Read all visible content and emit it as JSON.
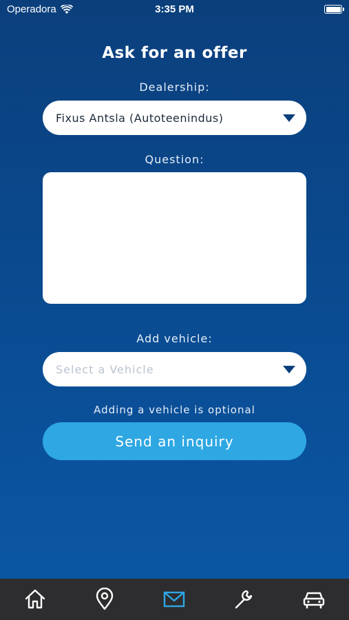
{
  "status_bar": {
    "carrier": "Operadora",
    "time": "3:35 PM"
  },
  "page": {
    "title": "Ask for an offer"
  },
  "dealership": {
    "label": "Dealership:",
    "selected": "Fixus Antsla (Autoteenindus)"
  },
  "question": {
    "label": "Question:",
    "value": ""
  },
  "vehicle": {
    "label": "Add vehicle:",
    "placeholder": "Select a Vehicle",
    "hint": "Adding a vehicle is optional"
  },
  "actions": {
    "send_label": "Send an inquiry"
  },
  "colors": {
    "accent": "#2ea7e3",
    "tabbar": "#2d2d2f",
    "active_tab": "#2ea7e3"
  },
  "tabbar": {
    "items": [
      {
        "icon": "home-icon",
        "active": false
      },
      {
        "icon": "location-pin-icon",
        "active": false
      },
      {
        "icon": "mail-icon",
        "active": true
      },
      {
        "icon": "wrench-icon",
        "active": false
      },
      {
        "icon": "car-icon",
        "active": false
      }
    ]
  }
}
